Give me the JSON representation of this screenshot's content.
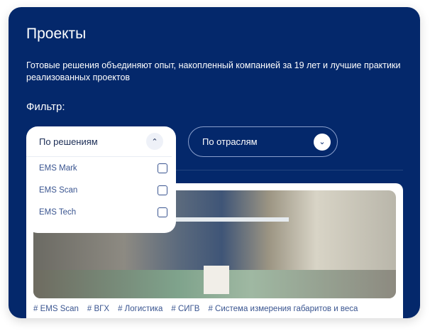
{
  "title": "Проекты",
  "description": "Готовые решения объединяют опыт, накопленный компанией за 19 лет и лучшие практики реализованных проектов",
  "filter_label": "Фильтр:",
  "filters": [
    {
      "label": "По решениям",
      "expanded": true,
      "options": [
        {
          "label": "EMS Mark",
          "checked": false
        },
        {
          "label": "EMS Scan",
          "checked": false
        },
        {
          "label": "EMS Tech",
          "checked": false
        }
      ]
    },
    {
      "label": "По отраслям",
      "expanded": false
    }
  ],
  "project": {
    "tags": [
      "# EMS Scan",
      "# ВГХ",
      "# Логистика",
      "# СИГВ",
      "# Система измерения габаритов и веса"
    ]
  },
  "colors": {
    "panel": "#04286b",
    "accent": "#3a5590"
  }
}
